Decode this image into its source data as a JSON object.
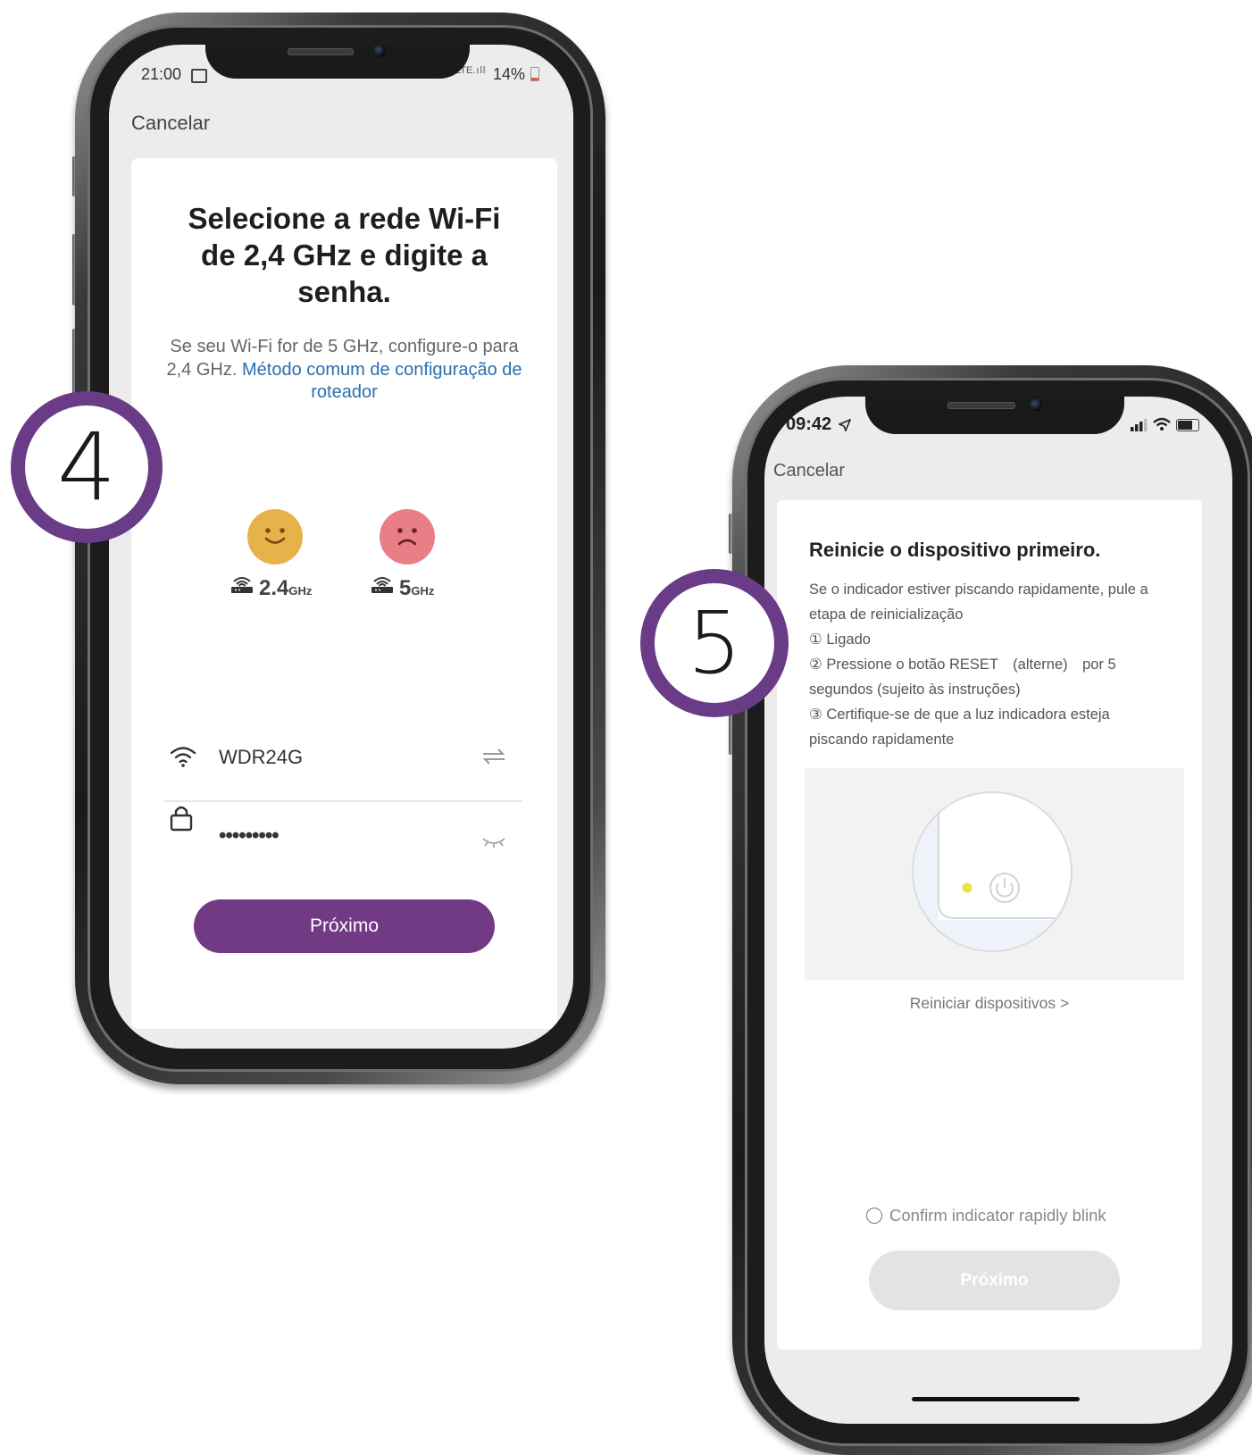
{
  "step_four": {
    "number": "4"
  },
  "step_five": {
    "number": "5"
  },
  "phone_android": {
    "status_time": "21:00",
    "status_battery": "14%",
    "cancel_label": "Cancelar",
    "title": "Selecione a rede Wi-Fi de 2,4 GHz e digite a senha.",
    "subtitle_text": "Se seu Wi-Fi for de 5 GHz, configure-o para 2,4 GHz.",
    "subtitle_link": "Método comum de configuração de roteador",
    "band_good": {
      "value": "2.4",
      "unit": "GHz"
    },
    "band_bad": {
      "value": "5",
      "unit": "GHz"
    },
    "ssid_value": "WDR24G",
    "password_value": "•••••••••",
    "next_label": "Próximo",
    "colors": {
      "accent": "#723a85",
      "good_face": "#e8b24b",
      "bad_face": "#e97f86",
      "link": "#2a6fb0"
    }
  },
  "phone_ios": {
    "status_time": "09:42",
    "cancel_label": "Cancelar",
    "title": "Reinicie o dispositivo primeiro.",
    "body_lines": [
      "Se o indicador estiver piscando rapidamente, pule a",
      "etapa de reinicialização",
      "① Ligado",
      "② Pressione o botão RESET　(alterne)　por 5",
      "segundos (sujeito às instruções)",
      "③ Certifique-se de que a luz indicadora esteja",
      "piscando rapidamente"
    ],
    "reset_link": "Reiniciar dispositivos >",
    "confirm_label": "Confirm indicator rapidly blink",
    "next_label": "Próximo",
    "colors": {
      "step_circle": "#6a3b87",
      "disabled_button": "#e3e3e3",
      "indicator_led": "#e8e24b"
    }
  }
}
